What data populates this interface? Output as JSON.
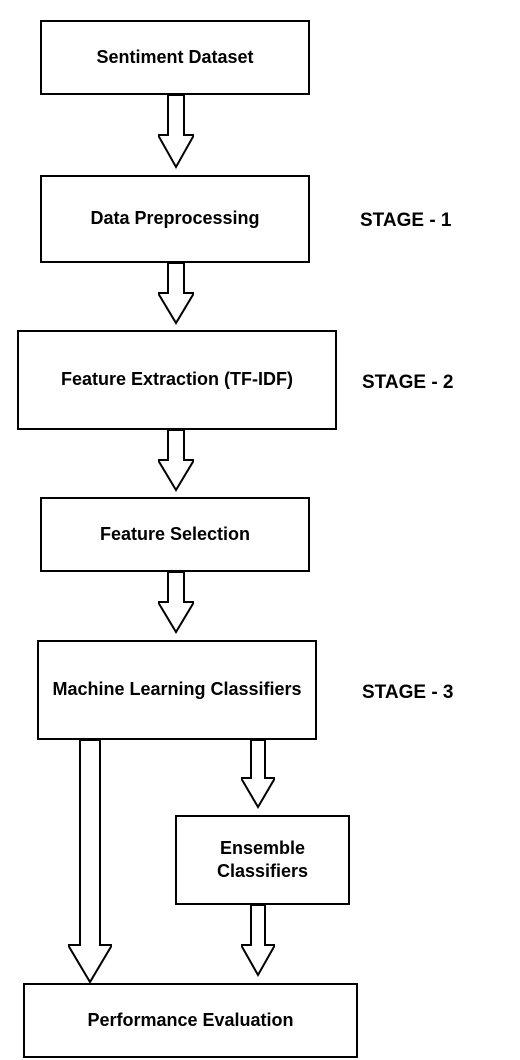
{
  "boxes": {
    "sentiment_dataset": "Sentiment Dataset",
    "data_preprocessing": "Data Preprocessing",
    "feature_extraction": "Feature Extraction (TF-IDF)",
    "feature_selection": "Feature Selection",
    "ml_classifiers": "Machine Learning Classifiers",
    "ensemble_classifiers": "Ensemble Classifiers",
    "performance_evaluation": "Performance Evaluation"
  },
  "stages": {
    "stage1": "STAGE - 1",
    "stage2": "STAGE - 2",
    "stage3": "STAGE - 3"
  }
}
